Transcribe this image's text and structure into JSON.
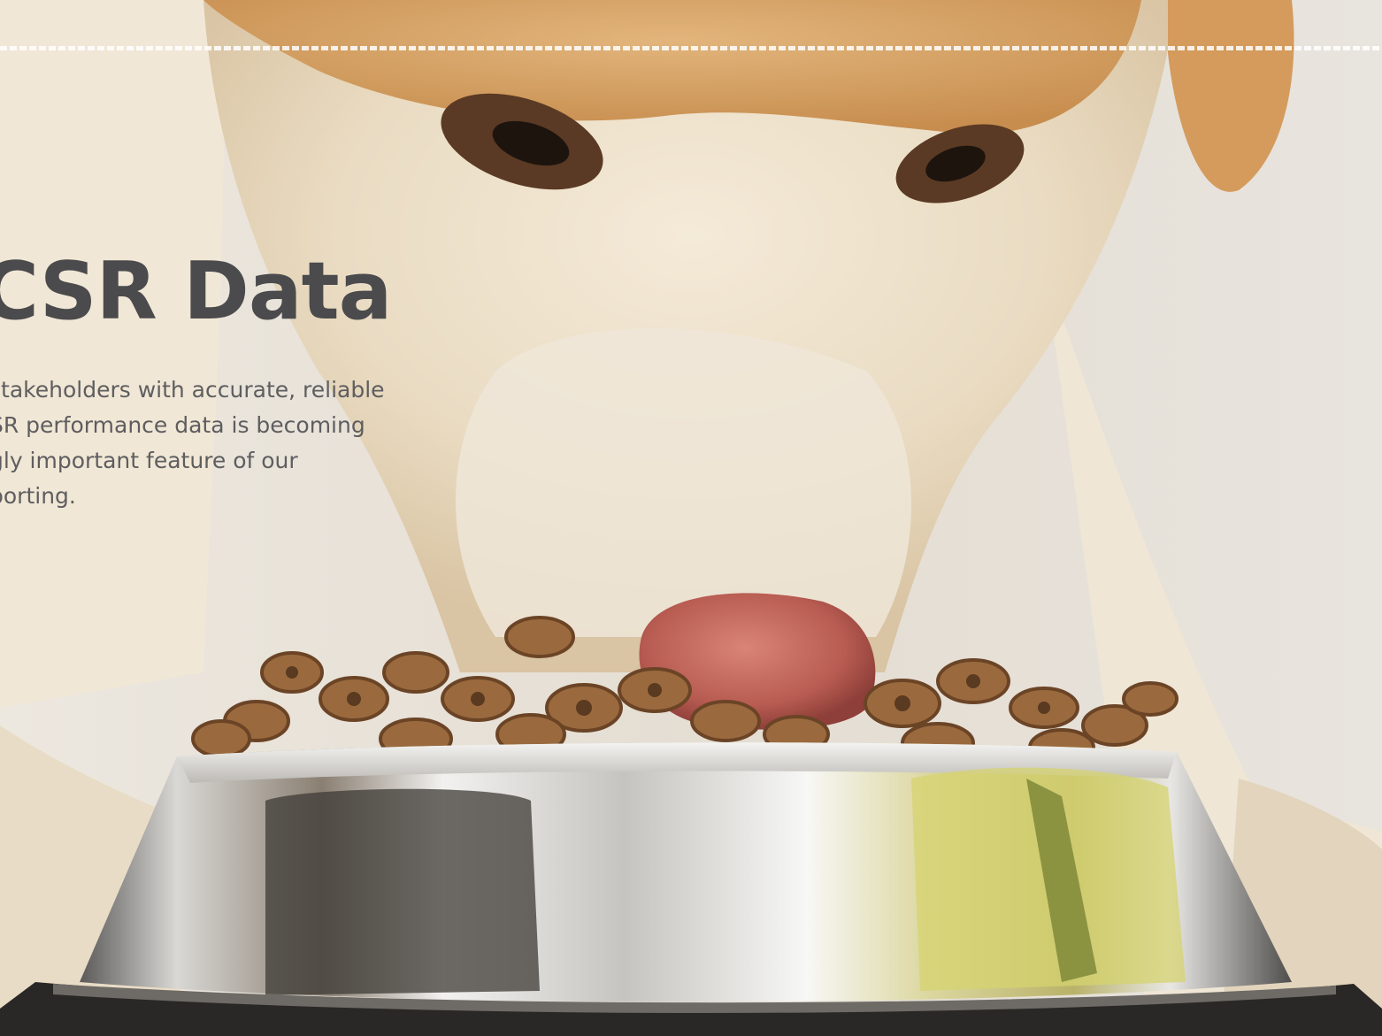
{
  "heading": {
    "title": "CSR Data"
  },
  "intro": {
    "lines": [
      "stakeholders with accurate, reliable",
      "SR performance data is becoming",
      "gly important feature of our",
      "porting."
    ]
  },
  "colors": {
    "title": "#4b4b4d",
    "body_text": "#5e5e60",
    "background": "#e9e4dc",
    "dash_rule": "#ffffff"
  },
  "image": {
    "subject": "dog-eating-kibble-from-steel-bowl"
  }
}
